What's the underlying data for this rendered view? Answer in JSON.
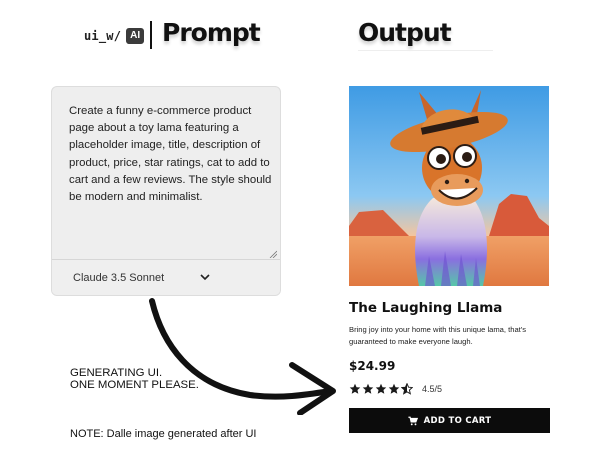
{
  "header": {
    "brand_text": "ui_w/",
    "brand_badge": "AI",
    "prompt_title": "Prompt",
    "output_title": "Output"
  },
  "prompt": {
    "text": "Create a funny e-commerce product page about a toy lama featuring a placeholder image, title, description of product, price, star ratings, cat to add to cart and a few reviews. The style should be modern and minimalist.",
    "model": "Claude 3.5 Sonnet"
  },
  "status": {
    "line1": "GENERATING UI.",
    "line2": "ONE MOMENT PLEASE.",
    "note": "NOTE: Dalle image generated after UI"
  },
  "product": {
    "title": "The Laughing Llama",
    "description": "Bring joy into your home with this unique lama, that's guaranteed to make everyone laugh.",
    "price": "$24.99",
    "rating": 4.5,
    "rating_max": 5,
    "rating_text": "4.5/5",
    "add_to_cart": "ADD TO CART"
  },
  "icons": {
    "cart": "cart-icon",
    "star": "star-icon",
    "chevron": "chevron-down-icon"
  },
  "colors": {
    "button_bg": "#0c0c0c",
    "card_bg": "#eeeeee",
    "llama_body": "#d9742a",
    "sky_top": "#4ba3e6",
    "desert": "#e88a55"
  }
}
